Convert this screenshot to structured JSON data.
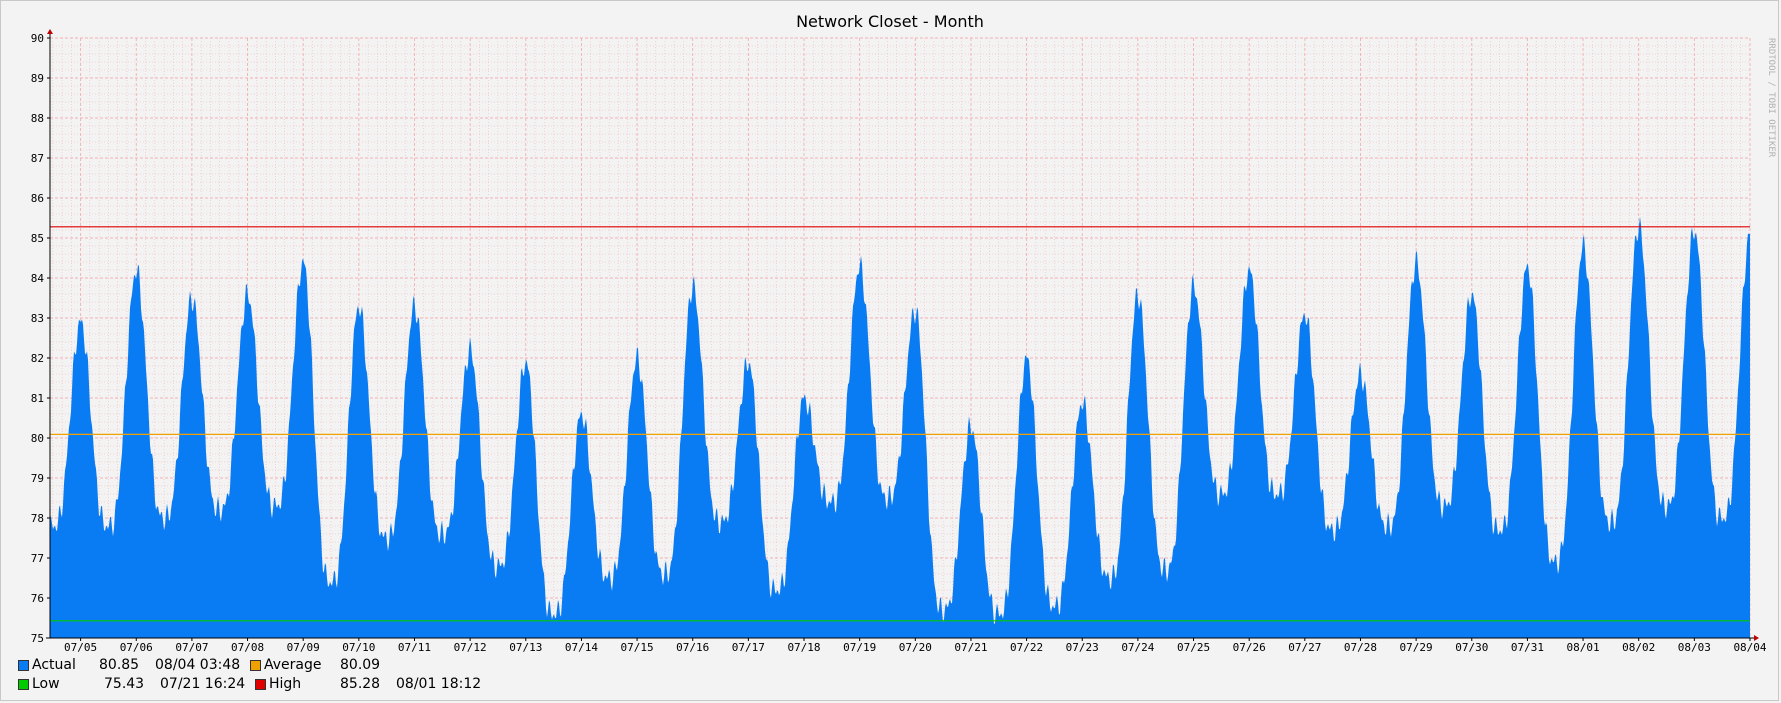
{
  "window": {
    "title": "Network Closet - Month"
  },
  "watermark": "RRDTOOL / TOBI OETIKER",
  "chart_data": {
    "type": "area",
    "title": "Network Closet - Month",
    "xlabel": "",
    "ylabel": "",
    "ylim": [
      75,
      90
    ],
    "y_ticks": [
      "75",
      "76",
      "77",
      "78",
      "79",
      "80",
      "81",
      "82",
      "83",
      "84",
      "85",
      "86",
      "87",
      "88",
      "89",
      "90"
    ],
    "x_ticks": [
      "07/05",
      "07/06",
      "07/07",
      "07/08",
      "07/09",
      "07/10",
      "07/11",
      "07/12",
      "07/13",
      "07/14",
      "07/15",
      "07/16",
      "07/17",
      "07/18",
      "07/19",
      "07/20",
      "07/21",
      "07/22",
      "07/23",
      "07/24",
      "07/25",
      "07/26",
      "07/27",
      "07/28",
      "07/29",
      "07/30",
      "07/31",
      "08/01",
      "08/02",
      "08/03",
      "08/04"
    ],
    "x_range_days": [
      -0.55,
      30.0
    ],
    "grid": true,
    "colors": {
      "actual": "#0a7cf3",
      "average": "#f0a000",
      "low": "#00cc00",
      "high": "#e00000",
      "grid": "#f2b0b0",
      "axis": "#000000"
    },
    "series": [
      {
        "name": "Actual",
        "daily": [
          {
            "peak": 82.9,
            "low": 77.8
          },
          {
            "peak": 84.2,
            "low": 78.0
          },
          {
            "peak": 83.5,
            "low": 78.2
          },
          {
            "peak": 83.6,
            "low": 78.3
          },
          {
            "peak": 84.4,
            "low": 76.4
          },
          {
            "peak": 83.3,
            "low": 77.5
          },
          {
            "peak": 83.3,
            "low": 77.6
          },
          {
            "peak": 82.2,
            "low": 76.8
          },
          {
            "peak": 81.9,
            "low": 75.6
          },
          {
            "peak": 80.6,
            "low": 76.5
          },
          {
            "peak": 82.0,
            "low": 76.6
          },
          {
            "peak": 83.8,
            "low": 77.9
          },
          {
            "peak": 81.9,
            "low": 76.2
          },
          {
            "peak": 81.0,
            "low": 78.4
          },
          {
            "peak": 84.3,
            "low": 78.5
          },
          {
            "peak": 83.2,
            "low": 75.7
          },
          {
            "peak": 80.3,
            "low": 75.6
          },
          {
            "peak": 82.0,
            "low": 75.8
          },
          {
            "peak": 80.9,
            "low": 76.5
          },
          {
            "peak": 83.6,
            "low": 76.7
          },
          {
            "peak": 83.8,
            "low": 78.6
          },
          {
            "peak": 84.2,
            "low": 78.6
          },
          {
            "peak": 83.1,
            "low": 77.7
          },
          {
            "peak": 81.6,
            "low": 77.8
          },
          {
            "peak": 84.4,
            "low": 78.3
          },
          {
            "peak": 83.6,
            "low": 77.7
          },
          {
            "peak": 84.3,
            "low": 76.9
          },
          {
            "peak": 84.8,
            "low": 77.9
          },
          {
            "peak": 85.3,
            "low": 78.3
          },
          {
            "peak": 85.2,
            "low": 78.0
          },
          {
            "peak": 85.1,
            "low": 80.9
          }
        ]
      },
      {
        "name": "Average",
        "value": 80.09
      },
      {
        "name": "Low",
        "value": 75.43
      },
      {
        "name": "High",
        "value": 85.28
      }
    ]
  },
  "legend": {
    "actual": {
      "label": "Actual",
      "value": "80.85",
      "time": "08/04 03:48"
    },
    "average": {
      "label": "Average",
      "value": "80.09"
    },
    "low": {
      "label": "Low",
      "value": "75.43",
      "time": "07/21 16:24"
    },
    "high": {
      "label": "High",
      "value": "85.28",
      "time": "08/01 18:12"
    }
  }
}
